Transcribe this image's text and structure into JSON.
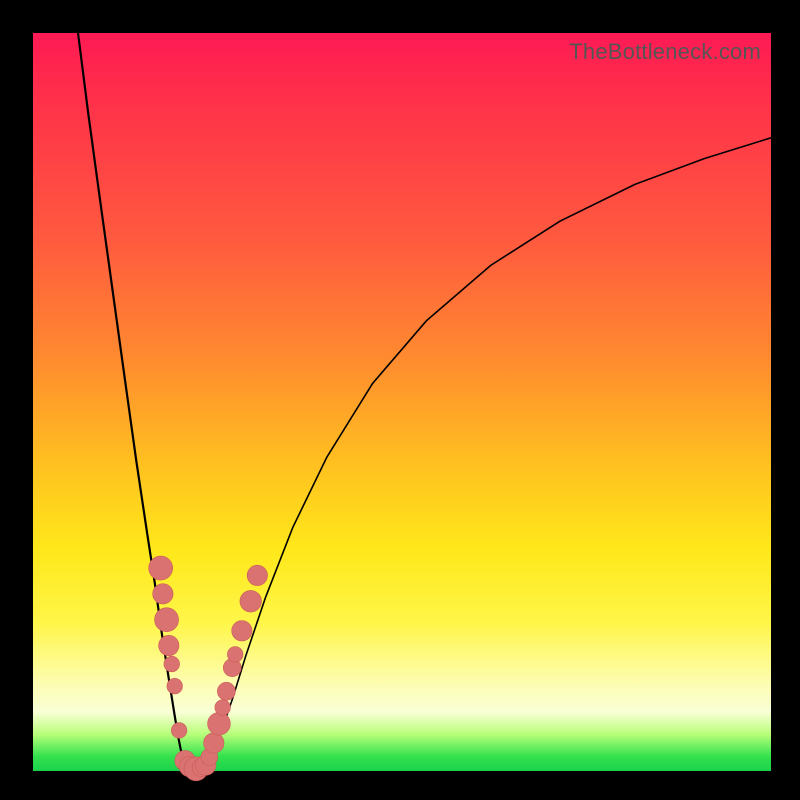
{
  "attribution": "TheBottleneck.com",
  "colors": {
    "frame": "#000000",
    "gradient_top": "#ff1a55",
    "gradient_mid": "#ffe81a",
    "gradient_bottom": "#19d24a",
    "curve": "#000000",
    "dot_fill": "#d97270",
    "dot_stroke": "#cc5c59"
  },
  "chart_data": {
    "type": "line",
    "title": "",
    "xlabel": "",
    "ylabel": "",
    "xlim": [
      0,
      100
    ],
    "ylim": [
      0,
      100
    ],
    "grid": false,
    "legend_position": "none",
    "annotations": [
      "TheBottleneck.com"
    ],
    "series": [
      {
        "name": "left_branch",
        "x": [
          6.1,
          7.5,
          9.0,
          10.8,
          12.6,
          14.0,
          15.5,
          16.5,
          17.4,
          18.4,
          19.2,
          19.7,
          20.2,
          20.7
        ],
        "y": [
          100.0,
          89.0,
          78.0,
          65.0,
          52.0,
          42.0,
          32.0,
          25.5,
          19.0,
          12.5,
          7.5,
          4.5,
          2.0,
          0.7
        ]
      },
      {
        "name": "valley",
        "x": [
          20.7,
          21.2,
          21.8,
          22.4,
          22.9,
          23.5
        ],
        "y": [
          0.7,
          0.3,
          0.15,
          0.15,
          0.3,
          0.7
        ]
      },
      {
        "name": "right_branch",
        "x": [
          23.5,
          24.4,
          25.6,
          27.1,
          28.8,
          31.5,
          35.2,
          39.8,
          46.0,
          53.3,
          62.0,
          71.4,
          81.6,
          91.0,
          100.0
        ],
        "y": [
          0.7,
          2.4,
          5.6,
          10.0,
          15.5,
          23.5,
          33.0,
          42.5,
          52.5,
          61.0,
          68.5,
          74.5,
          79.5,
          83.0,
          85.8
        ]
      }
    ],
    "marker_points": {
      "name": "highlight_dots",
      "points": [
        {
          "x": 17.3,
          "y": 27.5,
          "r": 2.0
        },
        {
          "x": 17.6,
          "y": 24.0,
          "r": 1.7
        },
        {
          "x": 18.1,
          "y": 20.5,
          "r": 2.0
        },
        {
          "x": 18.4,
          "y": 17.0,
          "r": 1.7
        },
        {
          "x": 18.8,
          "y": 14.5,
          "r": 1.3
        },
        {
          "x": 19.2,
          "y": 11.5,
          "r": 1.3
        },
        {
          "x": 19.8,
          "y": 5.5,
          "r": 1.3
        },
        {
          "x": 20.6,
          "y": 1.4,
          "r": 1.7
        },
        {
          "x": 21.2,
          "y": 0.6,
          "r": 1.7
        },
        {
          "x": 22.1,
          "y": 0.3,
          "r": 2.0
        },
        {
          "x": 22.8,
          "y": 0.45,
          "r": 1.5
        },
        {
          "x": 23.4,
          "y": 0.8,
          "r": 1.7
        },
        {
          "x": 23.9,
          "y": 1.9,
          "r": 1.4
        },
        {
          "x": 24.5,
          "y": 3.8,
          "r": 1.7
        },
        {
          "x": 25.2,
          "y": 6.4,
          "r": 1.9
        },
        {
          "x": 25.7,
          "y": 8.6,
          "r": 1.3
        },
        {
          "x": 26.2,
          "y": 10.8,
          "r": 1.5
        },
        {
          "x": 27.0,
          "y": 14.0,
          "r": 1.5
        },
        {
          "x": 27.4,
          "y": 15.8,
          "r": 1.3
        },
        {
          "x": 28.3,
          "y": 19.0,
          "r": 1.7
        },
        {
          "x": 29.5,
          "y": 23.0,
          "r": 1.8
        },
        {
          "x": 30.4,
          "y": 26.5,
          "r": 1.7
        }
      ]
    }
  }
}
